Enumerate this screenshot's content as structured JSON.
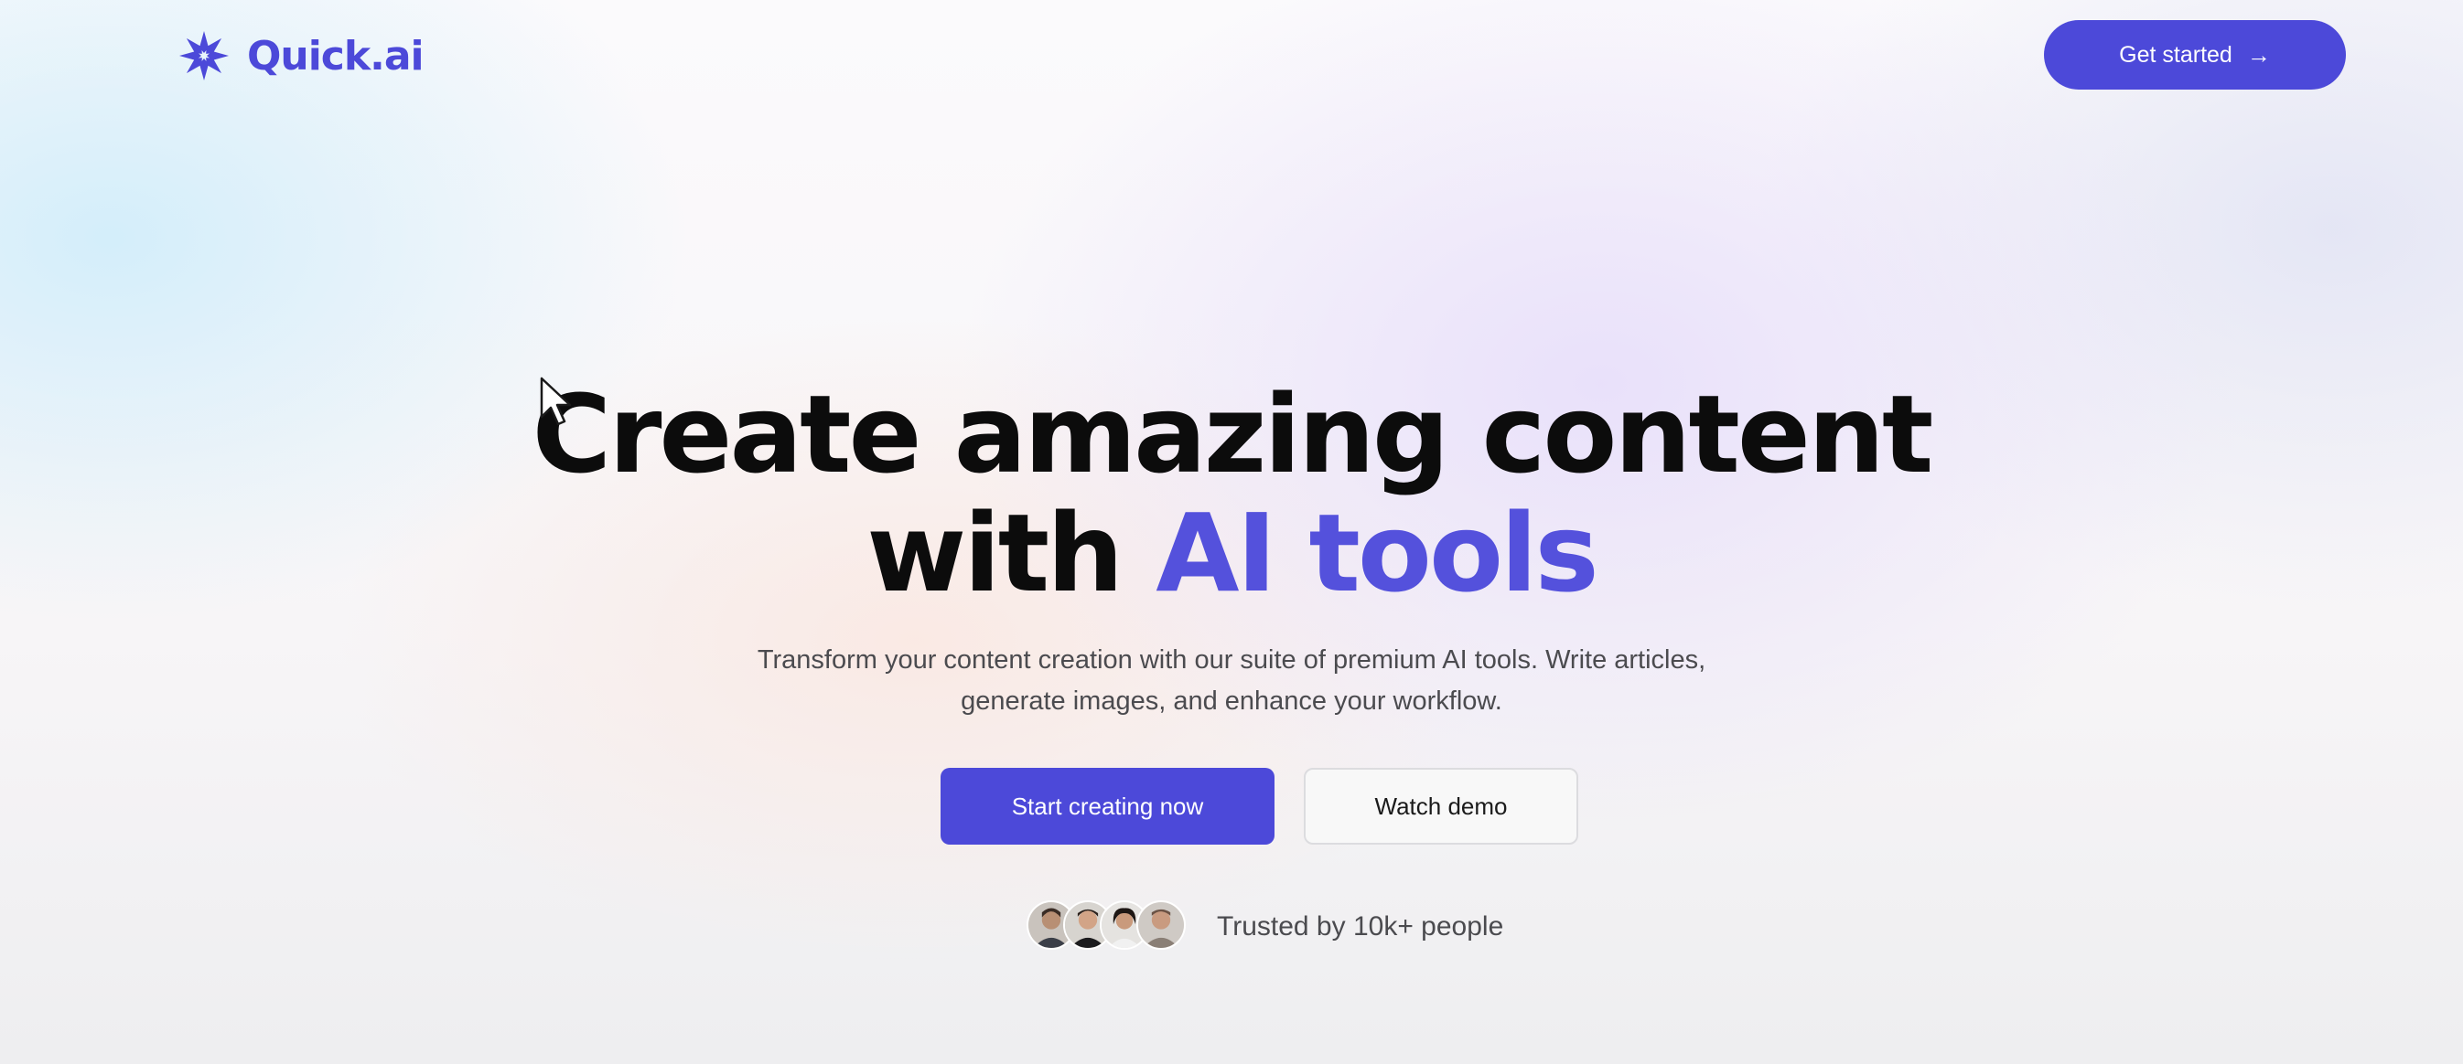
{
  "brand": {
    "name": "Quick.ai",
    "accent_color": "#4c49d9",
    "logo_icon": "snowflake-icon"
  },
  "header": {
    "cta_label": "Get started",
    "cta_icon": "arrow-right-icon"
  },
  "hero": {
    "headline_line1": "Create amazing content",
    "headline_line2_prefix": "with",
    "headline_highlight": "AI tools",
    "subtitle_line1": "Transform your content creation with our suite of premium AI tools. Write articles,",
    "subtitle_line2": "generate images, and enhance your workflow.",
    "primary_button": "Start creating now",
    "secondary_button": "Watch demo"
  },
  "social_proof": {
    "text": "Trusted by 10k+ people",
    "avatar_count": 4
  }
}
